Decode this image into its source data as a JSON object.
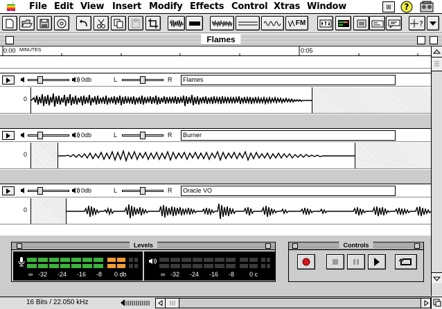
{
  "menubar": {
    "items": [
      "File",
      "Edit",
      "View",
      "Insert",
      "Modify",
      "Effects",
      "Control",
      "Xtras",
      "Window"
    ],
    "icons": [
      "apple-icon",
      "app-menu-icon",
      "help-icon",
      "application-icon"
    ]
  },
  "toolbar": {
    "fm_label": "FM"
  },
  "window": {
    "title": "Flames"
  },
  "timeline": {
    "start": "0:00",
    "start_unit": "MINUTES",
    "mark": "0:05"
  },
  "tracks": [
    {
      "name": "Flames",
      "volume": "0db",
      "pan_left": "L",
      "pan_right": "R",
      "zero": "0"
    },
    {
      "name": "Burner",
      "volume": "0db",
      "pan_left": "L",
      "pan_right": "R",
      "zero": "0"
    },
    {
      "name": "Oracle VO",
      "volume": "0db",
      "pan_left": "L",
      "pan_right": "R",
      "zero": "0"
    }
  ],
  "levels": {
    "title": "Levels",
    "scale": [
      "∞",
      "-32",
      "-24",
      "-16",
      "-8",
      "0 db"
    ],
    "scale_right": [
      "∞",
      "-32",
      "-24",
      "-16",
      "-8",
      "0 c"
    ],
    "colors": {
      "green": "#3bb33b",
      "orange": "#f39c34",
      "off": "#3a3a3a"
    }
  },
  "controls": {
    "title": "Controls",
    "record_color": "#d8141b"
  },
  "status": {
    "format": "16 Bits / 22.050 kHz"
  }
}
